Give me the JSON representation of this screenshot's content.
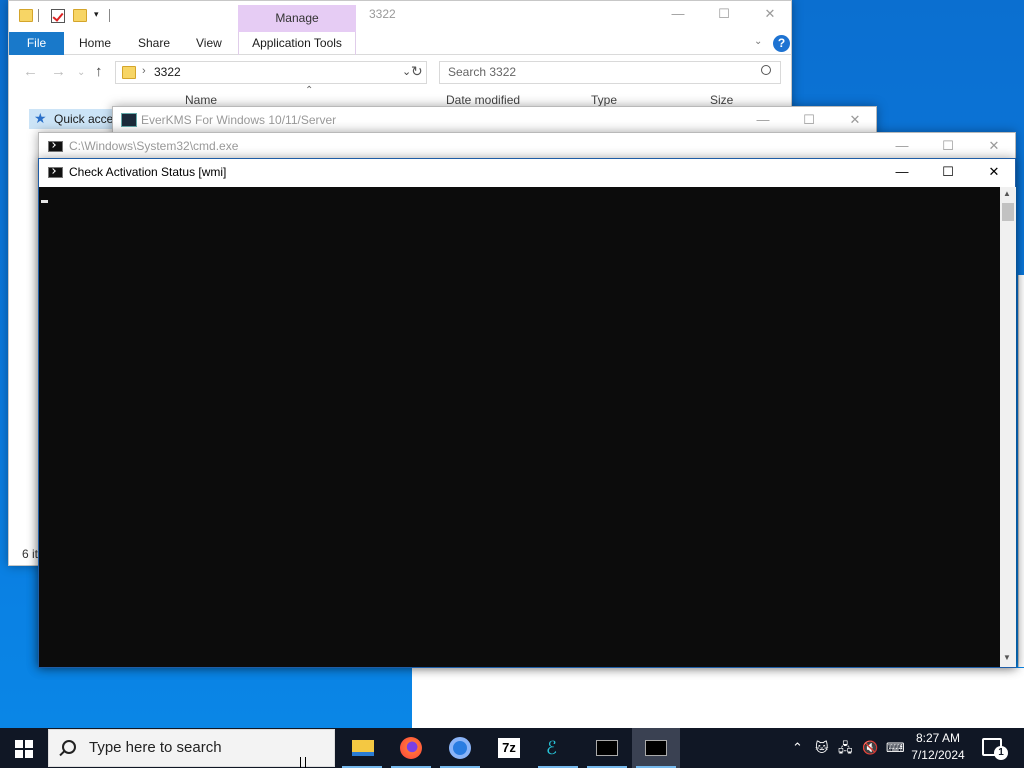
{
  "explorer": {
    "title": "3322",
    "manage_label": "Manage",
    "tabs": [
      "File",
      "Home",
      "Share",
      "View",
      "Application Tools"
    ],
    "address": "3322",
    "search_placeholder": "Search 3322",
    "columns": [
      "Name",
      "Date modified",
      "Type",
      "Size"
    ],
    "quick_access": "Quick acce",
    "status": "6 it",
    "help": "?"
  },
  "everkms": {
    "title": "EverKMS For Windows 10/11/Server"
  },
  "cmd_bg": {
    "title": "C:\\Windows\\System32\\cmd.exe"
  },
  "console": {
    "title": "Check Activation Status [wmi]"
  },
  "window_controls": {
    "minimize": "—",
    "maximize": "☐",
    "close": "✕"
  },
  "taskbar": {
    "search_placeholder": "Type here to search",
    "apps": [
      "file-explorer",
      "firefox",
      "chrome",
      "7zip",
      "everkms",
      "cmd",
      "cmd-active"
    ],
    "app_7z_label": "7z",
    "time": "8:27 AM",
    "date": "7/12/2024",
    "notifications": "1"
  },
  "colors": {
    "accent": "#1979ca",
    "manage_bg": "#e6ccf4",
    "console_bg": "#0c0c0c",
    "taskbar_bg": "#101725"
  }
}
